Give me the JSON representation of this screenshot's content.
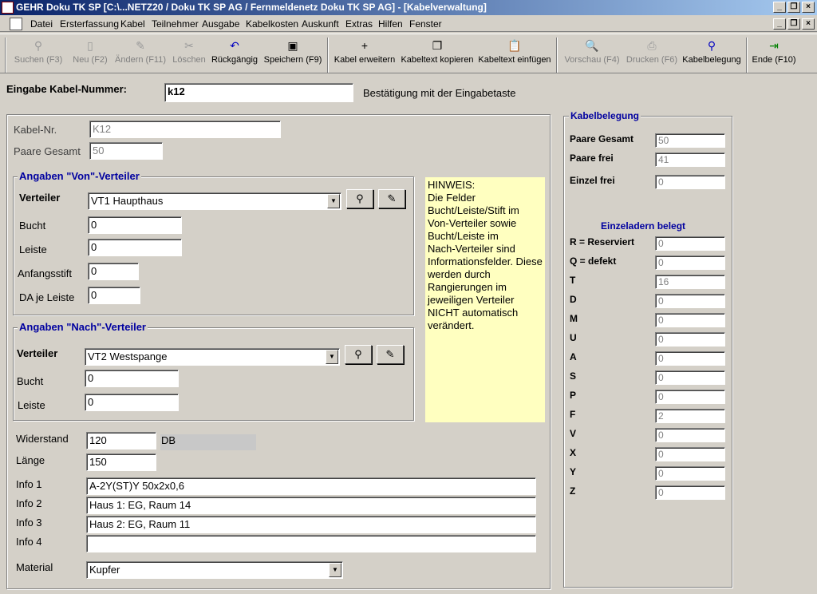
{
  "window": {
    "title": "GEHR Doku TK SP  [C:\\...NETZ20 / Doku TK SP AG / Fernmeldenetz Doku TK SP AG] - [Kabelverwaltung]"
  },
  "menu": [
    "Datei",
    "Ersterfassung",
    "Kabel",
    "Teilnehmer",
    "Ausgabe",
    "Kabelkosten",
    "Auskunft",
    "Extras",
    "Hilfen",
    "Fenster"
  ],
  "toolbar": {
    "search": "Suchen (F3)",
    "new": "Neu (F2)",
    "edit": "Ändern (F11)",
    "delete": "Löschen",
    "undo": "Rückgängig",
    "save": "Speichern (F9)",
    "extend": "Kabel erweitern",
    "copy_text": "Kabeltext kopieren",
    "paste_text": "Kabeltext einfügen",
    "preview": "Vorschau (F4)",
    "print": "Drucken (F6)",
    "assignment": "Kabelbelegung",
    "exit": "Ende (F10)"
  },
  "entry": {
    "label": "Eingabe Kabel-Nummer:",
    "value": "k12",
    "hint": "Bestätigung mit der Eingabetaste"
  },
  "cable": {
    "nr_label": "Kabel-Nr.",
    "nr_value": "K12",
    "pairs_label": "Paare Gesamt",
    "pairs_value": "50"
  },
  "von": {
    "title": "Angaben \"Von\"-Verteiler",
    "verteiler_label": "Verteiler",
    "verteiler_value": "VT1 Haupthaus",
    "bucht_label": "Bucht",
    "bucht_value": "0",
    "leiste_label": "Leiste",
    "leiste_value": "0",
    "anfangsstift_label": "Anfangsstift",
    "anfangsstift_value": "0",
    "da_label": "DA je Leiste",
    "da_value": "0"
  },
  "nach": {
    "title": "Angaben \"Nach\"-Verteiler",
    "verteiler_label": "Verteiler",
    "verteiler_value": "VT2 Westspange",
    "bucht_label": "Bucht",
    "bucht_value": "0",
    "leiste_label": "Leiste",
    "leiste_value": "0"
  },
  "hinweis": "HINWEIS:\nDie Felder\nBucht/Leiste/Stift im\nVon-Verteiler sowie\nBucht/Leiste im\nNach-Verteiler sind\nInformationsfelder. Diese\nwerden durch\nRangierungen im\njeweiligen Verteiler\nNICHT automatisch\nverändert.",
  "props": {
    "widerstand_label": "Widerstand",
    "widerstand_value": "120",
    "widerstand_unit": "DB",
    "laenge_label": "Länge",
    "laenge_value": "150",
    "info1_label": "Info 1",
    "info1_value": "A-2Y(ST)Y 50x2x0,6",
    "info2_label": "Info 2",
    "info2_value": "Haus 1: EG, Raum 14",
    "info3_label": "Info 3",
    "info3_value": "Haus 2: EG, Raum 11",
    "info4_label": "Info 4",
    "info4_value": "",
    "material_label": "Material",
    "material_value": "Kupfer"
  },
  "belegung": {
    "title": "Kabelbelegung",
    "paare_gesamt_label": "Paare Gesamt",
    "paare_gesamt_value": "50",
    "paare_frei_label": "Paare frei",
    "paare_frei_value": "41",
    "einzel_frei_label": "Einzel frei",
    "einzel_frei_value": "0",
    "einzeladern_title": "Einzeladern belegt",
    "rows": [
      {
        "label": "R = Reserviert",
        "value": "0"
      },
      {
        "label": "Q = defekt",
        "value": "0"
      },
      {
        "label": "T",
        "value": "16"
      },
      {
        "label": "D",
        "value": "0"
      },
      {
        "label": "M",
        "value": "0"
      },
      {
        "label": "U",
        "value": "0"
      },
      {
        "label": "A",
        "value": "0"
      },
      {
        "label": "S",
        "value": "0"
      },
      {
        "label": "P",
        "value": "0"
      },
      {
        "label": "F",
        "value": "2"
      },
      {
        "label": "V",
        "value": "0"
      },
      {
        "label": "X",
        "value": "0"
      },
      {
        "label": "Y",
        "value": "0"
      },
      {
        "label": "Z",
        "value": "0"
      }
    ]
  }
}
